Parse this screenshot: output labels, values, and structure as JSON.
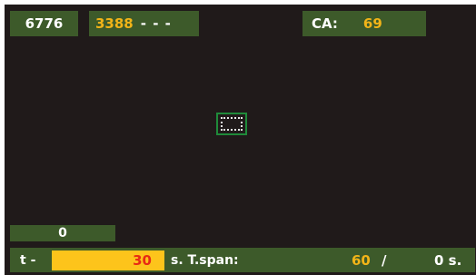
{
  "header": {
    "score": "6776",
    "half_value": "3388",
    "half_dashes": "- - -",
    "ca_label": "CA:",
    "ca_value": "69"
  },
  "counter": {
    "value": "0"
  },
  "footer": {
    "t_label": "t -",
    "t_value": "30",
    "tspan_label": "s. T.span:",
    "tspan_value": "60",
    "slash": "/",
    "seconds_label": "0 s."
  },
  "colors": {
    "background": "#201a1a",
    "panel": "#3d5a2a",
    "accent_yellow": "#f2b418",
    "input_yellow": "#fdc41b",
    "input_text_red": "#e82a14",
    "target_green": "#1f8a3a"
  }
}
